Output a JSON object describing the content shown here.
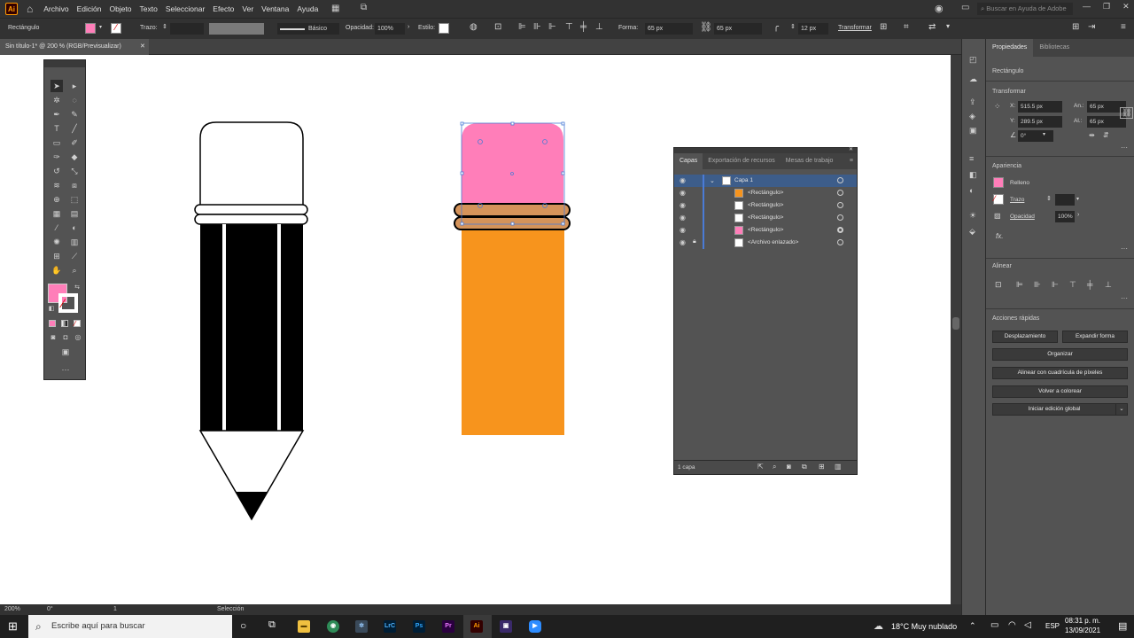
{
  "menubar": {
    "app_logo": "Ai",
    "menus": [
      "Archivo",
      "Edición",
      "Objeto",
      "Texto",
      "Seleccionar",
      "Efecto",
      "Ver",
      "Ventana",
      "Ayuda"
    ],
    "search_placeholder": "Buscar en Ayuda de Adobe"
  },
  "control_bar": {
    "object_type": "Rectángulo",
    "stroke_label": "Trazo:",
    "stroke_style": "Básico",
    "opacity_label": "Opacidad:",
    "opacity_value": "100%",
    "style_label": "Estilo:",
    "shape_label": "Forma:",
    "width_value": "65 px",
    "height_value": "65 px",
    "corner_value": "12 px",
    "transform_label": "Transformar",
    "fill_color": "#ff7eb9"
  },
  "document": {
    "tab_title": "Sin título-1* @ 200 % (RGB/Previsualizar)"
  },
  "status": {
    "zoom": "200%",
    "rotation": "0°",
    "artboard": "1",
    "tool": "Selección"
  },
  "layers_panel": {
    "tabs": [
      "Capas",
      "Exportación de recursos",
      "Mesas de trabajo"
    ],
    "layer_name": "Capa 1",
    "rows": [
      {
        "name": "<Rectángulo>",
        "thumb": "#f7941d"
      },
      {
        "name": "<Rectángulo>",
        "thumb": "#ffffff"
      },
      {
        "name": "<Rectángulo>",
        "thumb": "#ffffff"
      },
      {
        "name": "<Rectángulo>",
        "thumb": "#ff7eb9"
      },
      {
        "name": "<Archivo enlazado>",
        "thumb": "#ffffff"
      }
    ],
    "footer": "1 capa"
  },
  "properties_panel": {
    "tabs": [
      "Propiedades",
      "Bibliotecas"
    ],
    "object_type": "Rectángulo",
    "transform_title": "Transformar",
    "x_label": "X:",
    "x_value": "515.5 px",
    "y_label": "Y:",
    "y_value": "289.5 px",
    "w_label": "An.:",
    "w_value": "65 px",
    "h_label": "Al.:",
    "h_value": "65 px",
    "angle_value": "0°",
    "appearance_title": "Apariencia",
    "fill_label": "Relleno",
    "stroke_label": "Trazo",
    "opacity_label": "Opacidad",
    "opacity_value": "100%",
    "fx_label": "fx.",
    "align_title": "Alinear",
    "quick_actions_title": "Acciones rápidas",
    "btn_offset": "Desplazamiento",
    "btn_expand": "Expandir forma",
    "btn_arrange": "Organizar",
    "btn_pixel_align": "Alinear con cuadrícula de píxeles",
    "btn_recolor": "Volver a colorear",
    "btn_global_edit": "Iniciar edición global"
  },
  "artwork": {
    "eraser_color": "#ff7eb9",
    "ferrule_color": "#d4935a",
    "body_color": "#f7941d",
    "selection_color": "#4a7bd6"
  },
  "taskbar": {
    "search_placeholder": "Escribe aquí para buscar",
    "weather": "18°C  Muy nublado",
    "lang": "ESP",
    "time": "08:31 p. m.",
    "date": "13/09/2021",
    "apps": [
      "LrC",
      "Ps",
      "Pr",
      "Ai"
    ]
  }
}
